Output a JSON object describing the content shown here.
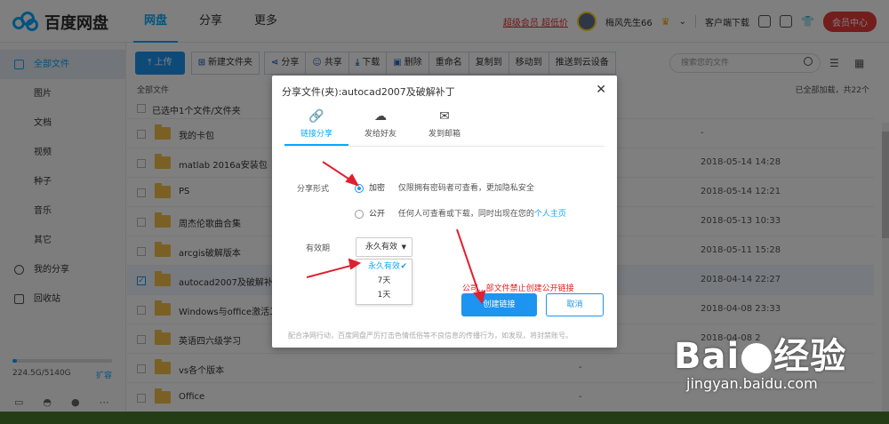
{
  "app": {
    "logo_text": "百度网盘"
  },
  "nav": {
    "tabs": [
      "网盘",
      "分享",
      "更多"
    ]
  },
  "header": {
    "vip_links": "超级会员 超低价",
    "username": "梅风先生66",
    "client_download": "客户端下载",
    "member_center": "会员中心"
  },
  "sidebar": {
    "items": [
      "全部文件",
      "图片",
      "文档",
      "视频",
      "种子",
      "音乐",
      "其它",
      "我的分享",
      "回收站"
    ],
    "quota_text": "224.5G/5140G",
    "expand_label": "扩容",
    "quota_used_fraction": 0.044
  },
  "toolbar": {
    "upload": "上传",
    "new_folder": "新建文件夹",
    "share": "分享",
    "co_share": "共享",
    "download": "下载",
    "delete": "删除",
    "rename": "重命名",
    "copy_to": "复制到",
    "move_to": "移动到",
    "push_cloud": "推送到云设备",
    "search_placeholder": "搜索您的文件"
  },
  "list": {
    "breadcrumb": "全部文件",
    "loaded_text": "已全部加载，共22个",
    "selected_text": "已选中1个文件/文件夹",
    "rows": [
      {
        "name": "我的卡包",
        "size": "",
        "date": "-",
        "selected": false
      },
      {
        "name": "matlab 2016a安装包",
        "size": "",
        "date": "2018-05-14 14:28",
        "selected": false
      },
      {
        "name": "PS",
        "size": "",
        "date": "2018-05-14 12:21",
        "selected": false
      },
      {
        "name": "周杰伦歌曲合集",
        "size": "",
        "date": "2018-05-13 10:33",
        "selected": false
      },
      {
        "name": "arcgis破解版本",
        "size": "",
        "date": "2018-05-11 15:28",
        "selected": false
      },
      {
        "name": "autocad2007及破解补丁",
        "size": "",
        "date": "2018-04-14 22:27",
        "selected": true
      },
      {
        "name": "Windows与office激活工具",
        "size": "",
        "date": "2018-04-08 23:33",
        "selected": false
      },
      {
        "name": "英语四六级学习",
        "size": "",
        "date": "2018-04-08 2",
        "selected": false
      },
      {
        "name": "vs各个版本",
        "size": "-",
        "date": "",
        "selected": false
      },
      {
        "name": "Office",
        "size": "-",
        "date": "",
        "selected": false
      }
    ]
  },
  "modal": {
    "title": "分享文件(夹):autocad2007及破解补丁",
    "tabs": [
      "链接分享",
      "发给好友",
      "发到邮箱"
    ],
    "share_form_label": "分享形式",
    "option_private": "加密",
    "option_private_desc": "仅限拥有密码者可查看，更加隐私安全",
    "option_public": "公开",
    "option_public_desc": "任何人可查看或下载，同时出现在您的",
    "option_public_link": "个人主页",
    "validity_label": "有效期",
    "validity_value": "永久有效",
    "validity_options": [
      "永久有效",
      "7天",
      "1天"
    ],
    "warning": "公司...部文件禁止创建公开链接",
    "create_button": "创建链接",
    "cancel_button": "取消",
    "footer": "配合净网行动，百度网盘严厉打击色情低俗等不良信息的传播行为，如发现，将封禁账号。"
  },
  "watermark": {
    "brand_pre": "Bai",
    "brand_post": "经验",
    "url": "jingyan.baidu.com"
  }
}
